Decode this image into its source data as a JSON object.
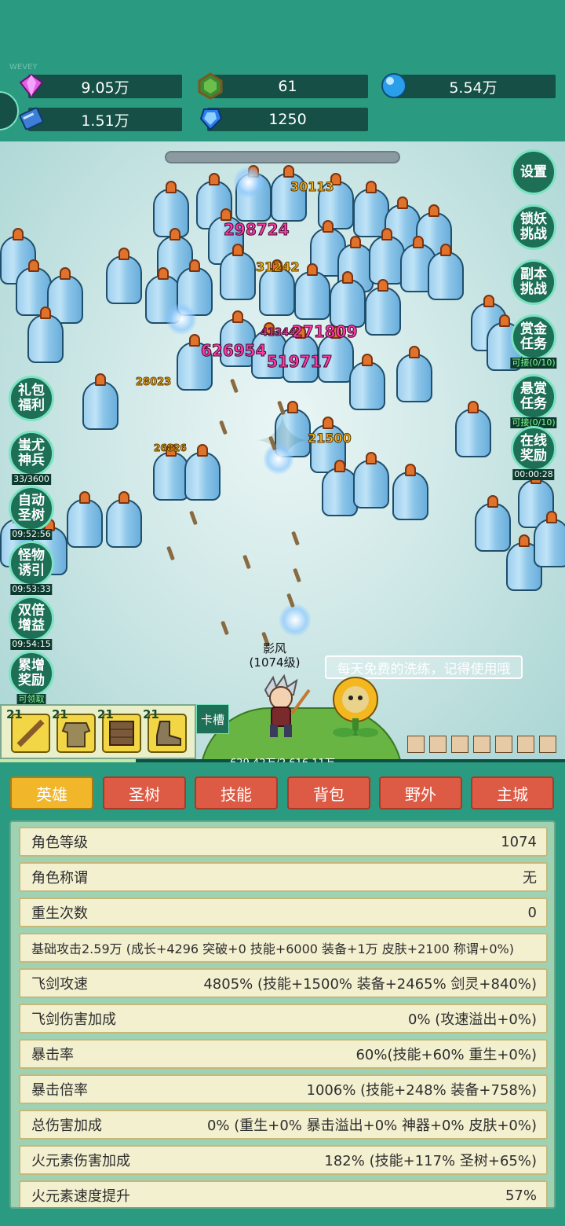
{
  "watermark": "WEVEY",
  "resources": [
    {
      "icon": "gem-icon",
      "value": "9.05万"
    },
    {
      "icon": "green-stone-icon",
      "value": "61"
    },
    {
      "icon": "blue-orb-icon",
      "value": "5.54万"
    },
    {
      "icon": "book-icon",
      "value": "1.51万"
    },
    {
      "icon": "blue-crystal-icon",
      "value": "1250"
    }
  ],
  "damage_numbers": [
    "30113",
    "298724",
    "31242",
    "41344",
    "271809",
    "626954",
    "519717",
    "28023",
    "21500",
    "26826"
  ],
  "right_buttons": {
    "settings": "设置",
    "lock_demon": "锁妖挑战",
    "dungeon": "副本挑战",
    "reward_task": "赏金任务",
    "reward_task_status": "可接(0/10)",
    "bounty_task": "悬赏任务",
    "bounty_task_status": "可接(0/10)",
    "online_reward": "在线奖励",
    "online_timer": "00:00:28"
  },
  "left_buttons": {
    "gift": "礼包福利",
    "weapon": "蚩尤神兵",
    "weapon_count": "33/3600",
    "auto_tree": "自动圣树",
    "auto_tree_timer": "09:52:56",
    "lure": "怪物诱引",
    "lure_timer": "09:53:33",
    "double": "双倍增益",
    "double_timer": "09:54:15",
    "accum": "累增奖励",
    "accum_status": "可领取"
  },
  "tip": "每天免费的洗练，记得使用哦",
  "hero": {
    "name": "影风",
    "level": "(1074级)"
  },
  "slots": [
    {
      "level": "21",
      "icon": "sword-icon"
    },
    {
      "level": "21",
      "icon": "armor-icon"
    },
    {
      "level": "21",
      "icon": "scroll-icon"
    },
    {
      "level": "21",
      "icon": "boots-icon"
    }
  ],
  "slot_button": "卡槽",
  "xp": {
    "text": "629.42万/2,616.11万",
    "fraction": 0.24
  },
  "tabs": [
    "英雄",
    "圣树",
    "技能",
    "背包",
    "野外",
    "主城"
  ],
  "stats": [
    {
      "label": "角色等级",
      "value": "1074"
    },
    {
      "label": "角色称谓",
      "value": "无"
    },
    {
      "label": "重生次数",
      "value": "0"
    },
    {
      "label": "基础攻击2.59万 (成长+4296 突破+0 技能+6000 装备+1万 皮肤+2100 称谓+0%)",
      "value": ""
    },
    {
      "label": "飞剑攻速",
      "value": "4805% (技能+1500% 装备+2465% 剑灵+840%)"
    },
    {
      "label": "飞剑伤害加成",
      "value": "0% (攻速溢出+0%)"
    },
    {
      "label": "暴击率",
      "value": "60%(技能+60% 重生+0%)"
    },
    {
      "label": "暴击倍率",
      "value": "1006% (技能+248% 装备+758%)"
    },
    {
      "label": "总伤害加成",
      "value": "0% (重生+0% 暴击溢出+0% 神器+0% 皮肤+0%)"
    },
    {
      "label": "火元素伤害加成",
      "value": "182% (技能+117% 圣树+65%)"
    },
    {
      "label": "火元素速度提升",
      "value": "57%"
    }
  ]
}
